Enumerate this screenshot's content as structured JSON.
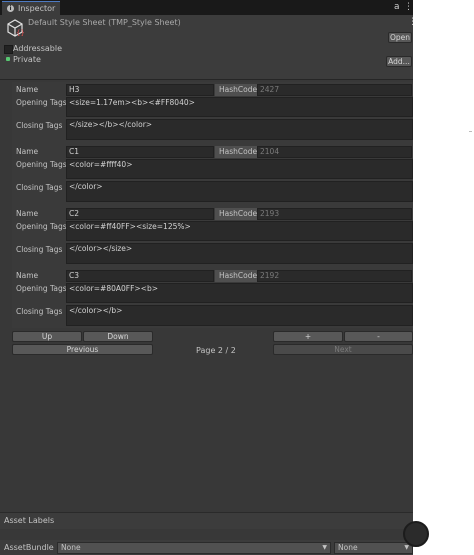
{
  "tab": {
    "label": "Inspector",
    "lock_glyph": "a",
    "menu_glyph": "⋮"
  },
  "asset": {
    "title": "Default Style Sheet (TMP_Style Sheet)",
    "open_label": "Open",
    "add_label": "Add...",
    "addressable_label": "Addressable",
    "private_label": "Private",
    "kebab": "⋮"
  },
  "styles": [
    {
      "name": "H3",
      "hashcode_label": "HashCode",
      "hashcode": "2427",
      "opening_label": "Opening Tags",
      "opening": "<size=1.17em><b><#FF8040>",
      "closing_label": "Closing Tags",
      "closing": "</size></b></color>"
    },
    {
      "name": "C1",
      "hashcode_label": "HashCode",
      "hashcode": "2104",
      "opening_label": "Opening Tags",
      "opening": "<color=#ffff40>",
      "closing_label": "Closing Tags",
      "closing": "</color>"
    },
    {
      "name": "C2",
      "hashcode_label": "HashCode",
      "hashcode": "2193",
      "opening_label": "Opening Tags",
      "opening": "<color=#ff40FF><size=125%>",
      "closing_label": "Closing Tags",
      "closing": "</color></size>"
    },
    {
      "name": "C3",
      "hashcode_label": "HashCode",
      "hashcode": "2192",
      "opening_label": "Opening Tags",
      "opening": "<color=#80A0FF><b>",
      "closing_label": "Closing Tags",
      "closing": "</color></b>"
    }
  ],
  "name_label": "Name",
  "controls": {
    "up": "Up",
    "down": "Down",
    "plus": "+",
    "minus": "-",
    "previous": "Previous",
    "next": "Next",
    "page": "Page 2 / 2"
  },
  "footer": {
    "asset_labels": "Asset Labels",
    "asset_bundle_label": "AssetBundle",
    "bundle_value": "None",
    "variant_value": "None"
  }
}
